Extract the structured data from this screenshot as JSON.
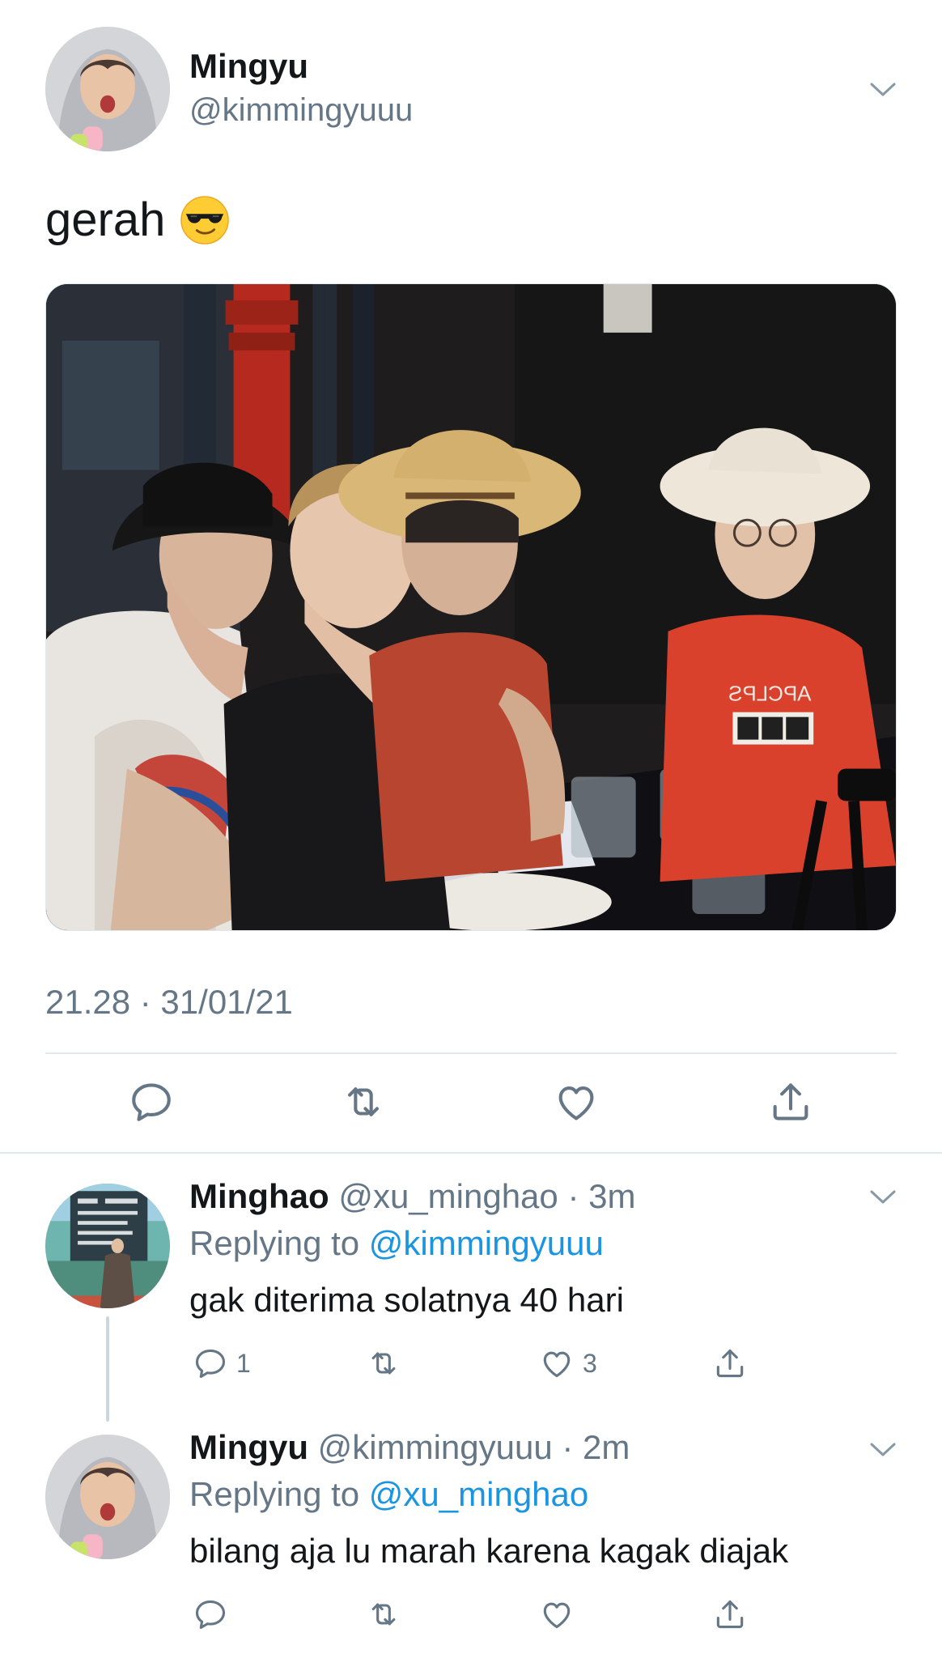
{
  "tweet": {
    "author_name": "Mingyu",
    "author_handle": "@kimmingyuuu",
    "text": "gerah",
    "emoji": "smiling-face-with-sunglasses",
    "timestamp": "21.28 · 31/01/21",
    "photo_shirt_text": "APCLPS",
    "actions": [
      "reply-icon",
      "retweet-icon",
      "like-icon",
      "share-icon"
    ]
  },
  "replies": [
    {
      "name": "Minghao",
      "handle": "@xu_minghao",
      "time": "· 3m",
      "replying_label": "Replying to",
      "replying_to": "@kimmingyuuu",
      "text": "gak diterima solatnya 40 hari",
      "reply_count": "1",
      "retweet_count": "",
      "like_count": "3"
    },
    {
      "name": "Mingyu",
      "handle": "@kimmingyuuu",
      "time": "· 2m",
      "replying_label": "Replying to",
      "replying_to": "@xu_minghao",
      "text": "bilang aja lu marah karena kagak diajak",
      "reply_count": "",
      "retweet_count": "",
      "like_count": ""
    }
  ],
  "colors": {
    "text": "#14171a",
    "secondary": "#657786",
    "link": "#1b95e0",
    "divider": "#e1e8ed",
    "thread_line": "#ccd6dd"
  }
}
